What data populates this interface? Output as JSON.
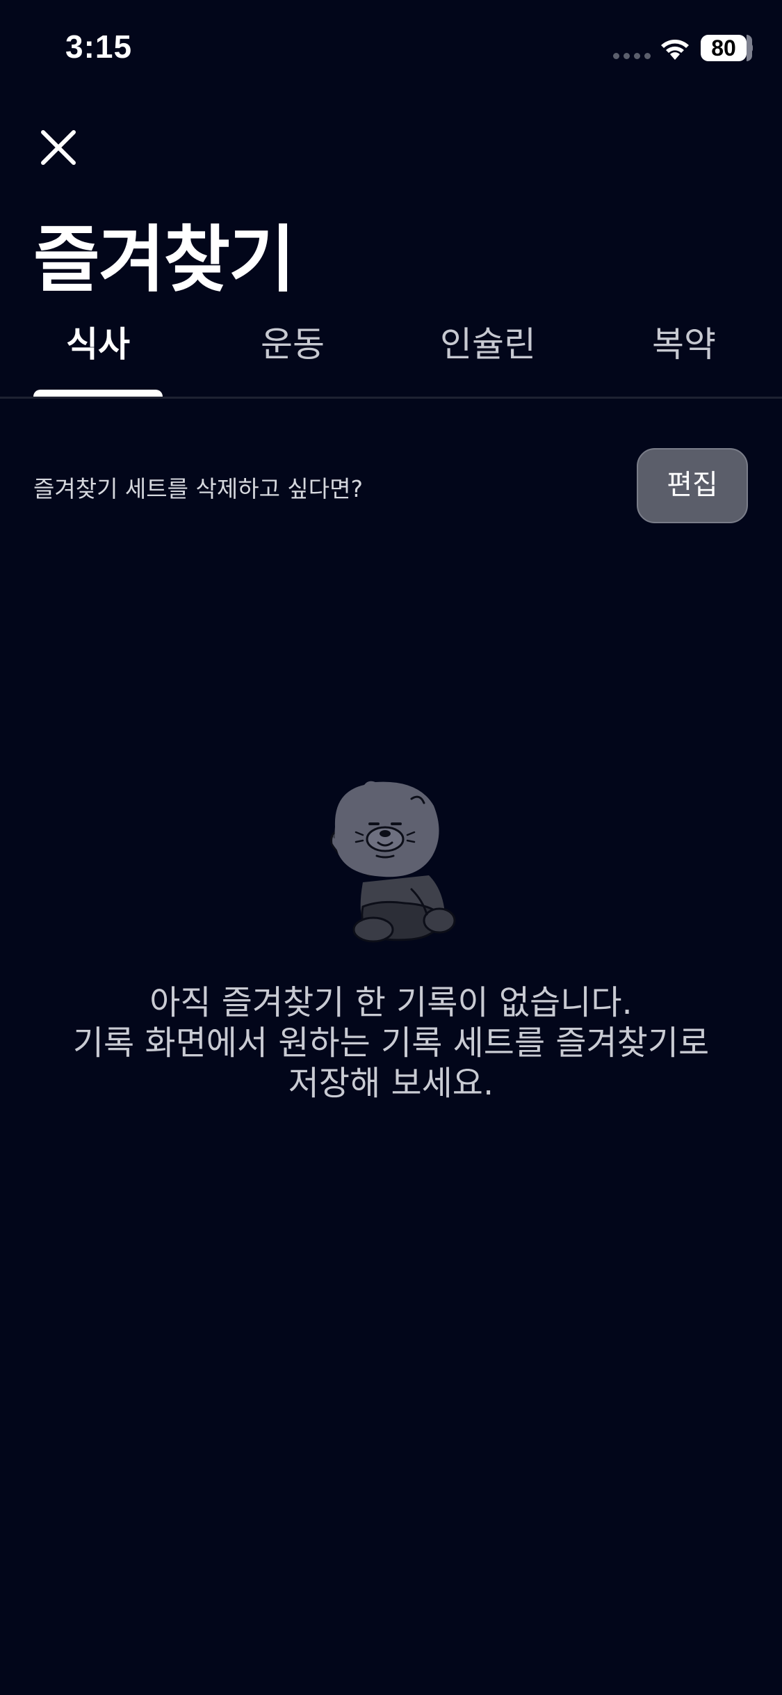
{
  "status_bar": {
    "time": "3:15",
    "battery_level": "80"
  },
  "header": {
    "close_icon": "close-icon",
    "title": "즐겨찾기"
  },
  "tabs": [
    {
      "label": "식사",
      "active": true
    },
    {
      "label": "운동",
      "active": false
    },
    {
      "label": "인슐린",
      "active": false
    },
    {
      "label": "복약",
      "active": false
    }
  ],
  "edit_row": {
    "hint": "즐겨찾기 세트를 삭제하고 싶다면?",
    "button_label": "편집"
  },
  "empty_state": {
    "illustration": "waving-bear-character",
    "line1": "아직 즐겨찾기 한 기록이 없습니다.",
    "line2": "기록 화면에서 원하는 기록 세트를 즐겨찾기로",
    "line3": "저장해 보세요."
  },
  "colors": {
    "background": "#02061a",
    "text_primary": "#ffffff",
    "text_secondary": "#c9cbd3",
    "button_bg": "#5b5e6a"
  }
}
